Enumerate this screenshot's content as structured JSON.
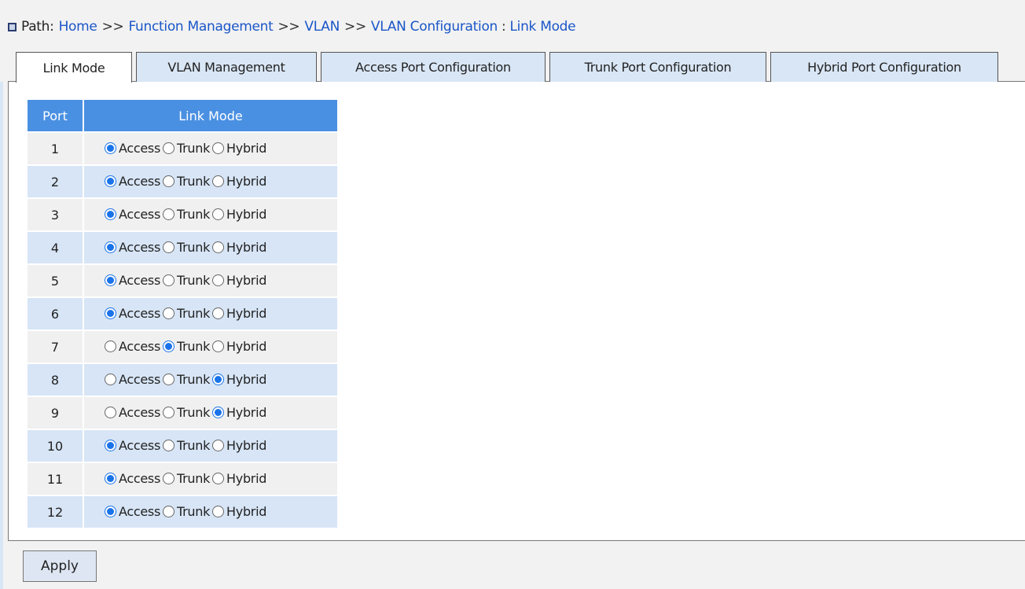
{
  "breadcrumb": {
    "label": "Path:",
    "items": [
      "Home",
      "Function Management",
      "VLAN",
      "VLAN Configuration"
    ],
    "separator": ">>",
    "current": "Link Mode"
  },
  "tabs": [
    {
      "label": "Link Mode",
      "active": true
    },
    {
      "label": "VLAN Management",
      "active": false
    },
    {
      "label": "Access Port Configuration",
      "active": false
    },
    {
      "label": "Trunk Port Configuration",
      "active": false
    },
    {
      "label": "Hybrid Port Configuration",
      "active": false
    }
  ],
  "table": {
    "headers": [
      "Port",
      "Link Mode"
    ],
    "options": [
      "Access",
      "Trunk",
      "Hybrid"
    ],
    "rows": [
      {
        "port": "1",
        "mode": "Access"
      },
      {
        "port": "2",
        "mode": "Access"
      },
      {
        "port": "3",
        "mode": "Access"
      },
      {
        "port": "4",
        "mode": "Access"
      },
      {
        "port": "5",
        "mode": "Access"
      },
      {
        "port": "6",
        "mode": "Access"
      },
      {
        "port": "7",
        "mode": "Trunk"
      },
      {
        "port": "8",
        "mode": "Hybrid"
      },
      {
        "port": "9",
        "mode": "Hybrid"
      },
      {
        "port": "10",
        "mode": "Access"
      },
      {
        "port": "11",
        "mode": "Access"
      },
      {
        "port": "12",
        "mode": "Access"
      }
    ]
  },
  "apply_label": "Apply",
  "colors": {
    "header": "#4a90e2",
    "row_odd": "#f0f0f0",
    "row_even": "#d7e5f6",
    "link": "#1a56c8",
    "radio_selected": "#1a73e8"
  }
}
